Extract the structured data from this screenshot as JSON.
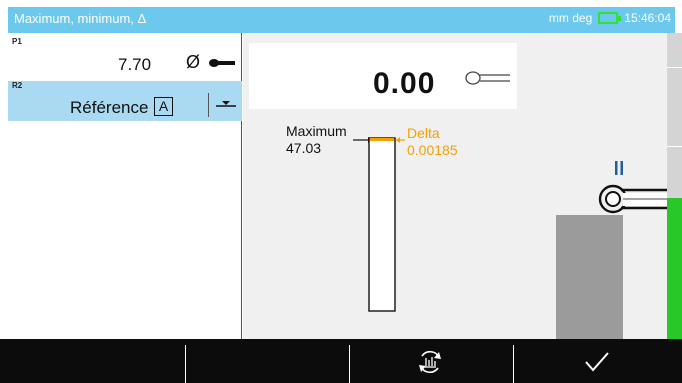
{
  "header": {
    "title": "Maximum, minimum, Δ",
    "units": "mm deg",
    "battery_icon": "battery-charging-icon",
    "time": "15:46:04"
  },
  "left_panel": {
    "p1": {
      "tag": "P1",
      "value": "7.70",
      "symbol": "Ø",
      "icon": "probe-icon"
    },
    "r2": {
      "tag": "R2",
      "label": "Référence",
      "badge": "A",
      "icon": "reference-set-icon",
      "selected": true
    }
  },
  "display": {
    "value": "0.00",
    "icon": "probe-outline-icon"
  },
  "gauge": {
    "max_label": "Maximum",
    "max_value": "47.03",
    "delta_label": "Delta",
    "delta_value": "0.00185",
    "pause_icon": "pause-icon"
  },
  "softkeys": {
    "key3_icon": "refresh-chart-icon",
    "key4_icon": "checkmark-icon"
  },
  "colors": {
    "header_bg": "#6cc8ec",
    "selected_row_bg": "#a9daf1",
    "delta": "#f5a000",
    "strip_green": "#28c828",
    "battery": "#35e035",
    "softkey_bar": "#0c0c0c"
  }
}
